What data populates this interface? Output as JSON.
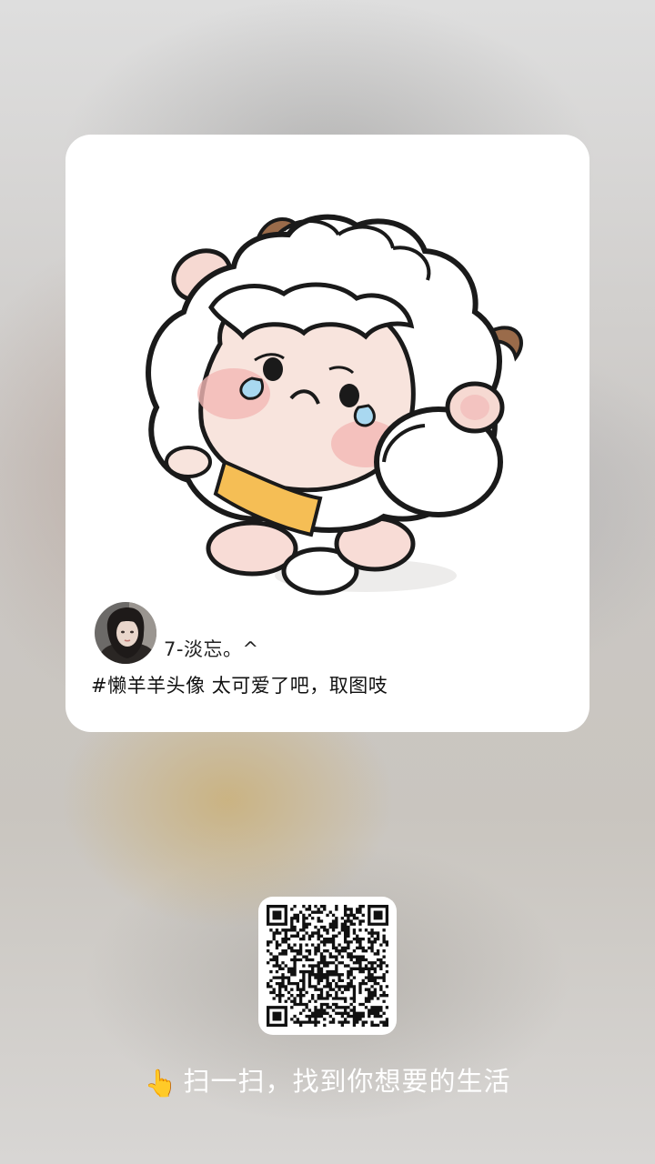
{
  "post": {
    "author_name": "7-淡忘。^",
    "caption": "#懒羊羊头像 太可爱了吧，取图吱"
  },
  "scan": {
    "hand_icon": "👆",
    "text": "扫一扫，找到你想要的生活"
  },
  "colors": {
    "card_bg": "#ffffff",
    "sheep_wool": "#ffffff",
    "sheep_face": "#f7e2dc",
    "blush": "#f3b8b5",
    "horn": "#9a6b4a",
    "bib": "#f5be55",
    "scan_text": "#ffffff"
  }
}
